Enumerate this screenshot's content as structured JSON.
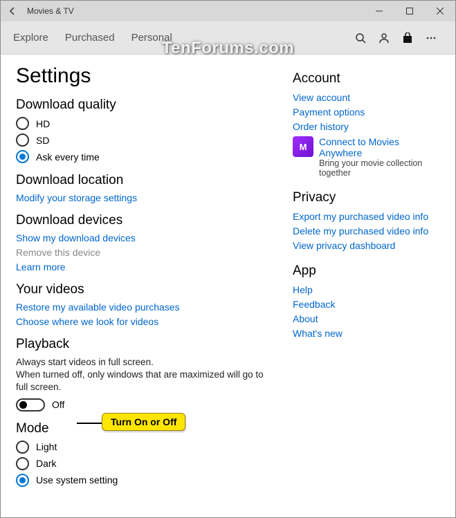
{
  "titlebar": {
    "title": "Movies & TV"
  },
  "topnav": {
    "tabs": [
      "Explore",
      "Purchased",
      "Personal"
    ]
  },
  "watermark": "TenForums.com",
  "page_title": "Settings",
  "download_quality": {
    "heading": "Download quality",
    "options": [
      "HD",
      "SD",
      "Ask every time"
    ],
    "selected": 2
  },
  "download_location": {
    "heading": "Download location",
    "link": "Modify your storage settings"
  },
  "download_devices": {
    "heading": "Download devices",
    "show": "Show my download devices",
    "remove": "Remove this device",
    "learn": "Learn more"
  },
  "your_videos": {
    "heading": "Your videos",
    "restore": "Restore my available video purchases",
    "choose": "Choose where we look for videos"
  },
  "playback": {
    "heading": "Playback",
    "line1": "Always start videos in full screen.",
    "line2": "When turned off, only windows that are maximized will go to full screen.",
    "state": "Off"
  },
  "mode": {
    "heading": "Mode",
    "options": [
      "Light",
      "Dark",
      "Use system setting"
    ],
    "selected": 2
  },
  "account": {
    "heading": "Account",
    "view": "View account",
    "payment": "Payment options",
    "order": "Order history",
    "ma_title": "Connect to Movies Anywhere",
    "ma_sub": "Bring your movie collection together"
  },
  "privacy": {
    "heading": "Privacy",
    "export": "Export my purchased video info",
    "delete": "Delete my purchased video info",
    "dashboard": "View privacy dashboard"
  },
  "app": {
    "heading": "App",
    "help": "Help",
    "feedback": "Feedback",
    "about": "About",
    "whats_new": "What's new"
  },
  "callout": "Turn On or Off"
}
